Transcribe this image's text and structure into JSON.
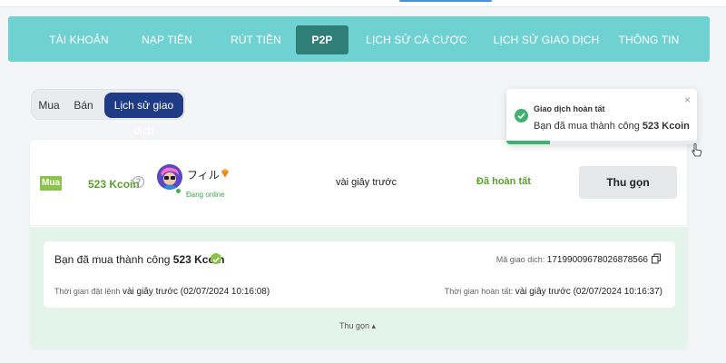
{
  "nav": {
    "items": [
      {
        "label": "TÀI KHOẢN",
        "active": false
      },
      {
        "label": "NẠP TIỀN",
        "active": false
      },
      {
        "label": "RÚT TIỀN",
        "active": false
      },
      {
        "label": "P2P",
        "active": true
      },
      {
        "label": "LỊCH SỬ CÁ CƯỢC",
        "active": false
      },
      {
        "label": "LỊCH SỬ GIAO DỊCH",
        "active": false
      },
      {
        "label": "THÔNG TIN",
        "active": false
      }
    ]
  },
  "tabs": {
    "buy": "Mua",
    "sell": "Bán",
    "history": "Lịch sử giao dịch",
    "active": "history"
  },
  "order": {
    "type_badge": "Mua",
    "amount": "523 Kcoin",
    "help": "?",
    "user": {
      "name": "フィル",
      "status": "Đang online"
    },
    "time_ago": "vài giây trước",
    "status": "Đã hoàn tất",
    "collapse_button": "Thu gọn"
  },
  "detail": {
    "title_prefix": "Bạn đã mua thành công ",
    "title_amount": "523 Kcoin",
    "txid_label": "Mã giao dịch: ",
    "txid": "17199009678026878566",
    "ordered_label": "Thời gian đặt lệnh ",
    "ordered_value": "vài giây trước (02/07/2024 10:16:08)",
    "completed_label": "Thời gian hoàn tất: ",
    "completed_value": "vài giây trước (02/07/2024 10:16:37)",
    "collapse_link": "Thu gọn ▴"
  },
  "toast": {
    "title": "Giao dịch hoàn tất",
    "message_prefix": "Bạn đã mua thành công ",
    "message_amount": "523 Kcoin",
    "close": "×",
    "progress": 0.23
  },
  "colors": {
    "nav_bg": "#6fd1d1",
    "nav_active": "#2f7e78",
    "tab_active": "#1f3b86",
    "success_green": "#5aa02c",
    "badge_green": "#8bc34a",
    "toast_green": "#3db46d",
    "detail_bg": "#e3f5ea"
  }
}
